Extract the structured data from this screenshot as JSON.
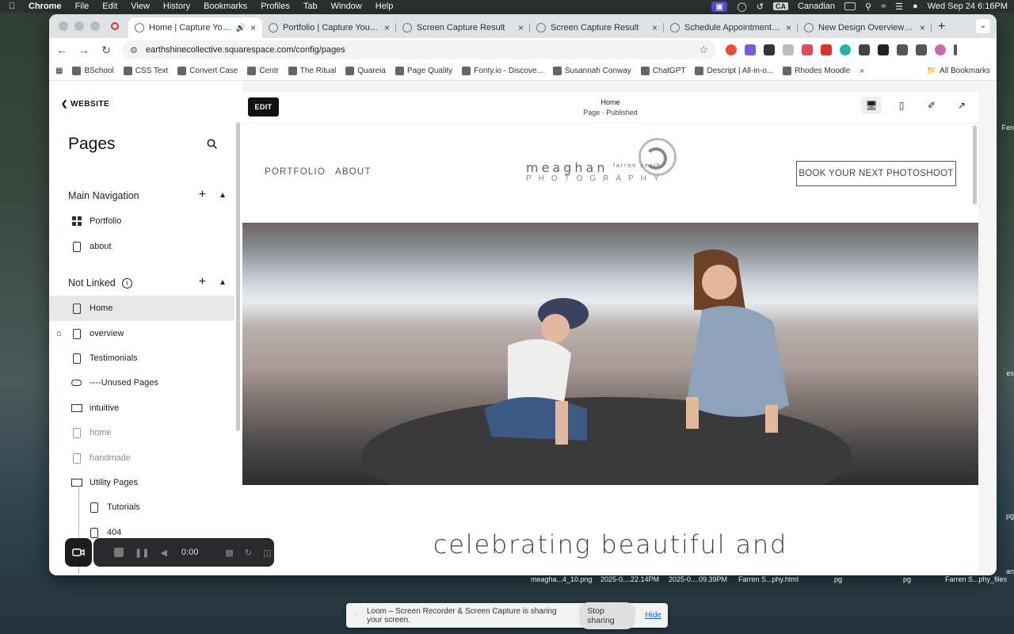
{
  "menubar": {
    "app": "Chrome",
    "items": [
      "File",
      "Edit",
      "View",
      "History",
      "Bookmarks",
      "Profiles",
      "Tab",
      "Window",
      "Help"
    ],
    "input_source": "Canadian",
    "clock": "Wed Sep 24  6:16PM",
    "calendar_badge": "26"
  },
  "tabs": [
    {
      "title": "Home | Capture Your Uni",
      "active": true
    },
    {
      "title": "Portfolio | Capture Your Mom"
    },
    {
      "title": "Screen Capture Result"
    },
    {
      "title": "Screen Capture Result"
    },
    {
      "title": "Schedule Appointment with"
    },
    {
      "title": "New Design Overview | Meag"
    }
  ],
  "address": {
    "url": "earthshinecollective.squarespace.com/config/pages"
  },
  "bookmarks": [
    "BSchool",
    "CSS Text",
    "Convert Case",
    "Centr",
    "The Ritual",
    "Quareia",
    "Page Quality",
    "Fonty.io - Discove...",
    "Susannah Conway",
    "ChatGPT",
    "Descript | All-in-o...",
    "Rhodes Moodle"
  ],
  "bookmarks_all": "All Bookmarks",
  "sidebar": {
    "back": "WEBSITE",
    "title": "Pages",
    "main_nav": "Main Navigation",
    "main_items": [
      "Portfolio",
      "about"
    ],
    "not_linked": "Not Linked",
    "not_linked_items": [
      "Home",
      "overview",
      "Testimonials",
      "----Unused Pages",
      "intuitive",
      "home",
      "handmade",
      "Utility Pages"
    ],
    "utility_items": [
      "Tutorials",
      "404"
    ]
  },
  "preview": {
    "edit": "EDIT",
    "page_title": "Home",
    "page_status": "Page · Published",
    "nav": [
      "PORTFOLIO",
      "ABOUT"
    ],
    "logo_name": "meaghan",
    "logo_mid": "farren smith",
    "logo_sub": "PHOTOGRAPHY",
    "cta": "BOOK YOUR NEXT PHOTOSHOOT",
    "tagline": "celebrating beautiful and"
  },
  "loom": {
    "timer": "0:00",
    "share_text": "Loom – Screen Recorder & Screen Capture is sharing your screen.",
    "stop": "Stop sharing",
    "hide": "Hide"
  },
  "desktop_files": [
    "meagha...4_10.png",
    "2025-0....22.14PM",
    "2025-0....09.39PM",
    "Farren S...phy.html",
    "pg",
    "pg",
    "Farren S...phy_files"
  ],
  "desktop_edge": [
    "Fen",
    "es",
    "an",
    "pg"
  ]
}
